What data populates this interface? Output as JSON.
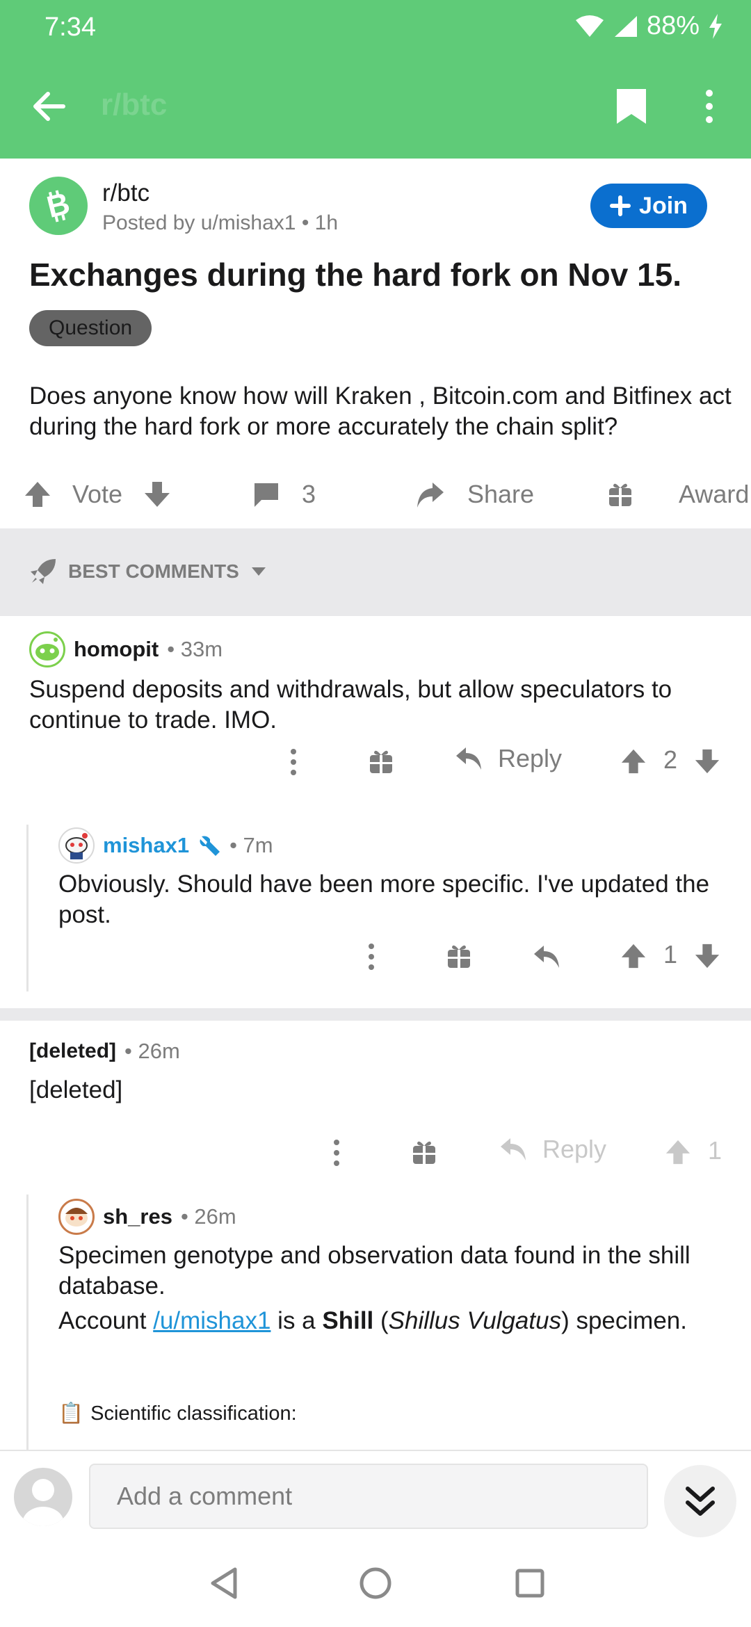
{
  "status_bar": {
    "time": "7:34",
    "battery": "88%"
  },
  "app_bar": {
    "ghost_title": "r/btc"
  },
  "post": {
    "subreddit": "r/btc",
    "posted_by": "Posted by u/mishax1 • 1h",
    "join_label": "Join",
    "title": "Exchanges during the hard fork on Nov 15.",
    "flair": "Question",
    "body": "Does anyone know how will Kraken , Bitcoin.com and Bitfinex act during the hard fork or more accurately the chain split?",
    "vote_label": "Vote",
    "comment_count": "3",
    "share_label": "Share",
    "award_label": "Award"
  },
  "sort": {
    "label": "BEST COMMENTS"
  },
  "comments": [
    {
      "author": "homopit",
      "age": "• 33m",
      "text": "Suspend deposits and withdrawals, but allow speculators to continue to trade. IMO.",
      "reply_label": "Reply",
      "score": "2"
    },
    {
      "author": "mishax1",
      "age": "• 7m",
      "text": "Obviously.  Should have been more specific.  I've updated the post.",
      "score": "1"
    },
    {
      "author": "[deleted]",
      "age": "• 26m",
      "text": "[deleted]",
      "reply_label": "Reply",
      "score": "1"
    },
    {
      "author": "sh_res",
      "age": "• 26m",
      "text_line1": "Specimen genotype and observation data found in the shill database.",
      "account_prefix": "Account ",
      "account_link": "/u/mishax1",
      "account_mid": " is a ",
      "account_bold": "Shill",
      "account_paren_open": " (",
      "account_italic": "Shillus Vulgatus",
      "account_tail": ") specimen.",
      "classification_icon": "📋",
      "classification": "Scientific classification:"
    }
  ],
  "compose": {
    "placeholder": "Add a comment"
  },
  "colors": {
    "brand_green": "#5fcb78",
    "join_blue": "#0b6fcf",
    "op_blue": "#1f94d8"
  }
}
